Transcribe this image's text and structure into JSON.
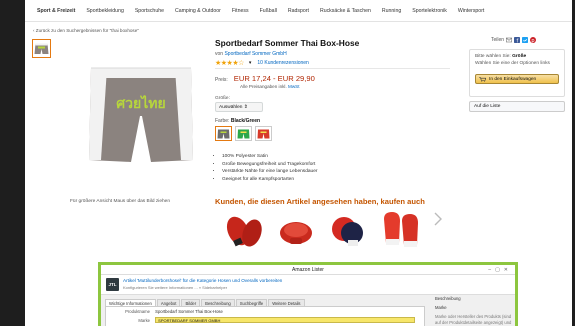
{
  "nav": {
    "items": [
      "Sport & Freizeit",
      "Sportbekleidung",
      "Sportschuhe",
      "Camping & Outdoor",
      "Fitness",
      "Fußball",
      "Radsport",
      "Rucksäcke & Taschen",
      "Running",
      "Sportelektronik",
      "Wintersport"
    ]
  },
  "breadcrumb": "‹ Zurück zu den Suchergebnissen für \"thai boxhose\"",
  "image_hint": "Für größere Ansicht Maus über das Bild ziehen",
  "product": {
    "logo_text": "ศวยไทย",
    "title": "Sportbedarf Sommer Thai Box-Hose",
    "by_prefix": "von",
    "by_brand": "Sportbedarf Sommer GmbH",
    "stars": "★★★★☆",
    "reviews": "10 Kundenrezensionen",
    "price_label": "Preis:",
    "price": "EUR 17,24 - EUR 29,90",
    "tax_text": "Alle Preisangaben inkl.",
    "tax_link": "MwSt",
    "size_label": "Größe:",
    "size_select": "Auswählen ⇕",
    "color_label": "Farbe:",
    "color_value": "Black/Green",
    "bullets": [
      "100% Polyester Satin",
      "Große Bewegungsfreiheit und Tragekomfort",
      "Verstärkte Nähte für eine lange Lebensdauer",
      "Geeignet für alle Kampfsportarten"
    ]
  },
  "sidebar": {
    "share_label": "Teilen",
    "buy_choose_label": "Bitte wählen Sie:",
    "buy_choose_value": "Größe",
    "buy_hint": "Wählen Sie eine der Optionen links",
    "cart_button": "In den Einkaufswagen",
    "wishlist_button": "Auf die Liste"
  },
  "also_bought": {
    "title": "Kunden, die diesen Artikel angesehen haben, kaufen auch"
  },
  "lister": {
    "window_title": "Amazon Lister",
    "logo": "JTL",
    "article_line": "Artikel 'Muttilunderborshosel' für die Kategorie Hosen und Overalls vorbereiten",
    "info_line": "Konfigurieren Sie weitere Informationen ... » Sidebarhelper",
    "tabs": [
      "Wichtige Informationen",
      "Angebot",
      "Bilder",
      "Beschreibung",
      "Suchbegriffe",
      "Weitere Details"
    ],
    "fields": [
      {
        "label": "Produktname",
        "value": "Sportbedarf Sommer Thai Box-Hose"
      },
      {
        "label": "Marke",
        "value": "SPORTBEDARF SOMMER GMBH"
      }
    ],
    "side_title": "Beschreibung",
    "side_field": "Marke",
    "side_text": "Marke oder Hersteller des Produkts (sind auf der Produktdetailseite angezeigt) und link für die Suche"
  },
  "colors": {
    "accent": "#e47911",
    "price": "#b12704",
    "link": "#0066c0",
    "frame": "#8dc63f",
    "shorts_body": "#8b837f",
    "shorts_trim": "#f2f2f2",
    "logo_text": "#b7d63c"
  }
}
